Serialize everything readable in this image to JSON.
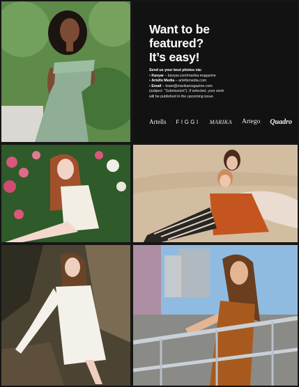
{
  "info": {
    "headline": [
      "Want to be",
      "featured?",
      "It’s easy!"
    ],
    "lead": "Send us your best photos via:",
    "items": [
      {
        "label": "Kavyar",
        "text": " – kavyar.com/marika-magazine"
      },
      {
        "label": "Artells Media",
        "text": " – artellsmedia.com"
      },
      {
        "label": "Email",
        "text": " – team@marikamagazine.com"
      }
    ],
    "submission_line": "(subject: “Submission”). If selected, your work",
    "publish_line": "will be published in the upcoming issue."
  },
  "logos": {
    "artells": "Artells",
    "figgi": "FIGGI",
    "marika": "MARIKA",
    "artego": "Artego",
    "quadro": "Quadro"
  },
  "colors": {
    "background": "#161616",
    "info_panel": "#121212",
    "text": "#ffffff"
  }
}
